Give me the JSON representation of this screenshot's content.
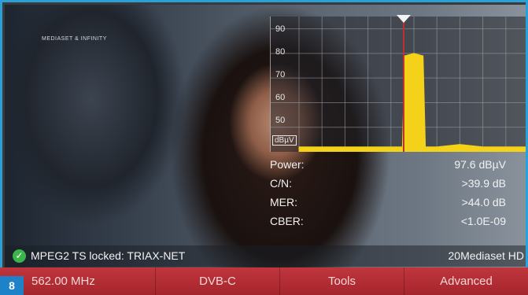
{
  "video": {
    "watermark": "MEDIASET & INFINITY"
  },
  "spectrum": {
    "y_ticks": [
      "90",
      "80",
      "70",
      "60",
      "50"
    ],
    "unit": "dBµV",
    "colors": {
      "signal": "#f5d21a",
      "marker": "#c03030",
      "grid": "#9aa0a8"
    }
  },
  "chart_data": {
    "type": "area",
    "ylabel": "dBµV",
    "y_ticks": [
      "90",
      "80",
      "70",
      "60",
      "50"
    ],
    "x": [
      0,
      10,
      20,
      30,
      40,
      45,
      46,
      50,
      54,
      55,
      60,
      70,
      80,
      90,
      100
    ],
    "values": [
      42,
      42,
      42,
      42,
      42,
      42,
      79,
      80,
      79,
      42,
      42,
      43,
      42,
      42,
      42
    ]
  },
  "measurements": [
    {
      "label": "Power:",
      "value": "97.6 dBµV"
    },
    {
      "label": "C/N:",
      "value": ">39.9 dB"
    },
    {
      "label": "MER:",
      "value": ">44.0 dB"
    },
    {
      "label": "CBER:",
      "value": "<1.0E-09"
    }
  ],
  "status": {
    "lock_text": "MPEG2 TS locked: TRIAX-NET",
    "service": "20Mediaset HD"
  },
  "softkeys": [
    "562.00 MHz",
    "DVB-C",
    "Tools",
    "Advanced"
  ],
  "badge": "8"
}
